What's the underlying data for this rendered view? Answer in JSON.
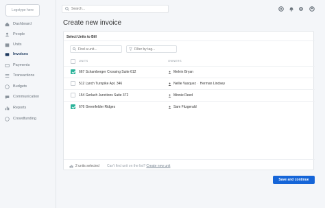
{
  "logo": {
    "text": "Logotype here"
  },
  "sidebar": {
    "items": [
      {
        "label": "Dashboard",
        "icon": "home-icon",
        "active": false
      },
      {
        "label": "People",
        "icon": "people-icon",
        "active": false
      },
      {
        "label": "Units",
        "icon": "units-icon",
        "active": false
      },
      {
        "label": "Invoices",
        "icon": "invoice-icon",
        "active": true
      },
      {
        "label": "Payments",
        "icon": "card-icon",
        "active": false
      },
      {
        "label": "Transactions",
        "icon": "list-icon",
        "active": false
      },
      {
        "label": "Budgets",
        "icon": "clock-icon",
        "active": false
      },
      {
        "label": "Communication",
        "icon": "chat-icon",
        "active": false
      },
      {
        "label": "Reports",
        "icon": "chart-icon",
        "active": false
      },
      {
        "label": "Crowdfunding",
        "icon": "heart-icon",
        "active": false
      }
    ]
  },
  "search": {
    "placeholder": "Search..."
  },
  "page": {
    "title": "Create new invoice"
  },
  "card": {
    "header": "Select Units to Bill",
    "find_placeholder": "Find a unit...",
    "tag_placeholder": "Filter by tag...",
    "col_units": "UNITS",
    "col_owners": "OWNERS"
  },
  "rows": [
    {
      "unit": "667 Schamberger Crossing Suite 612",
      "owners": [
        "Melvin Bryan"
      ],
      "checked": true
    },
    {
      "unit": "512 Lynch Turnpike Apt. 346",
      "owners": [
        "Nellie Vasquez",
        "Herman Lindsey"
      ],
      "checked": false
    },
    {
      "unit": "154 Gerlach Junctions Suite 372",
      "owners": [
        "Minnie Reed"
      ],
      "checked": false
    },
    {
      "unit": "676 Greenfelder Ridges",
      "owners": [
        "Sam Fitzgerald"
      ],
      "checked": true
    }
  ],
  "footer": {
    "selected": "2 units selected",
    "cant_find": "Can't find unit on the list?",
    "create_link": "Create new unit"
  },
  "button": {
    "label": "Save and continue"
  },
  "colors": {
    "accent": "#1565d8",
    "check": "#2bb39a",
    "active_nav": "#1e3a5f"
  }
}
